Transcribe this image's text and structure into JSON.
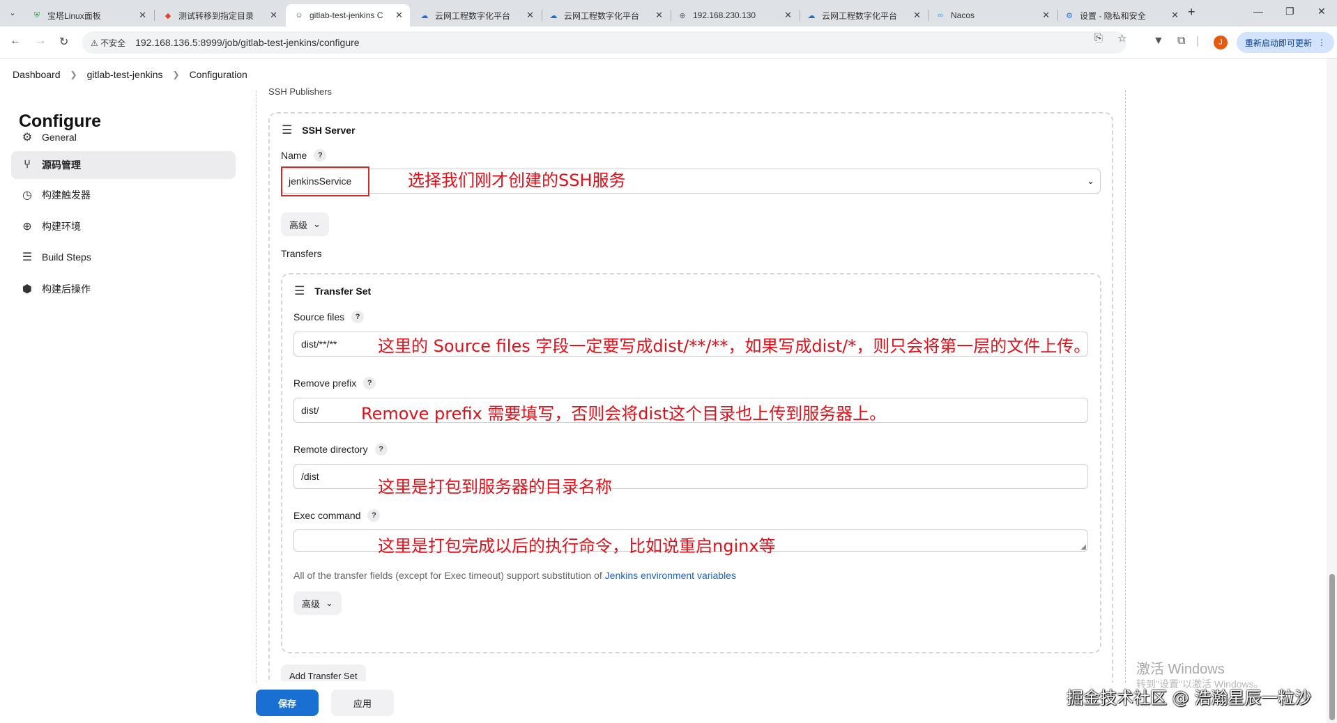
{
  "browser": {
    "tabs": [
      {
        "title": "宝塔Linux面板",
        "icon": "shield-icon",
        "color": "#20a53a",
        "active": false
      },
      {
        "title": "测试转移到指定目录",
        "icon": "gitlab-icon",
        "color": "#e24329",
        "active": false
      },
      {
        "title": "gitlab-test-jenkins C",
        "icon": "jenkins-icon",
        "color": "#555555",
        "active": true
      },
      {
        "title": "云网工程数字化平台",
        "icon": "cloud-icon",
        "color": "#1f6fd1",
        "active": false
      },
      {
        "title": "云网工程数字化平台",
        "icon": "cloud-icon",
        "color": "#1f6fd1",
        "active": false
      },
      {
        "title": "192.168.230.130",
        "icon": "globe-icon",
        "color": "#666666",
        "active": false
      },
      {
        "title": "云网工程数字化平台",
        "icon": "cloud-icon",
        "color": "#1f6fd1",
        "active": false
      },
      {
        "title": "Nacos",
        "icon": "nacos-icon",
        "color": "#2fa7e0",
        "active": false
      },
      {
        "title": "设置 - 隐私和安全",
        "icon": "gear-icon",
        "color": "#1a73e8",
        "active": false
      }
    ],
    "security_label": "不安全",
    "url": "192.168.136.5:8999/job/gitlab-test-jenkins/configure",
    "avatar_letter": "J",
    "relaunch_label": "重新启动即可更新"
  },
  "breadcrumb": [
    "Dashboard",
    "gitlab-test-jenkins",
    "Configuration"
  ],
  "sidebar": {
    "title": "Configure",
    "items": [
      {
        "label": "General",
        "icon": "gear-icon",
        "active": false
      },
      {
        "label": "源码管理",
        "icon": "branch-icon",
        "active": true
      },
      {
        "label": "构建触发器",
        "icon": "clock-icon",
        "active": false
      },
      {
        "label": "构建环境",
        "icon": "globe-icon",
        "active": false
      },
      {
        "label": "Build Steps",
        "icon": "list-icon",
        "active": false
      },
      {
        "label": "构建后操作",
        "icon": "cube-icon",
        "active": false
      }
    ]
  },
  "main": {
    "section_label": "SSH Publishers",
    "ssh_server": {
      "heading": "SSH Server",
      "name_label": "Name",
      "name_value": "jenkinsService",
      "annotation": "选择我们刚才创建的SSH服务",
      "advanced_label": "高级"
    },
    "transfers_label": "Transfers",
    "transfer_set": {
      "heading": "Transfer Set",
      "source_files": {
        "label": "Source files",
        "value": "dist/**/**",
        "annotation": "这里的 Source files 字段一定要写成dist/**/**，如果写成dist/*，则只会将第一层的文件上传。"
      },
      "remove_prefix": {
        "label": "Remove prefix",
        "value": "dist/",
        "annotation": "Remove prefix 需要填写，否则会将dist这个目录也上传到服务器上。"
      },
      "remote_directory": {
        "label": "Remote directory",
        "value": "/dist",
        "annotation": "这里是打包到服务器的目录名称"
      },
      "exec_command": {
        "label": "Exec command",
        "value": "",
        "annotation": "这里是打包完成以后的执行命令，比如说重启nginx等"
      },
      "note_text": "All of the transfer fields (except for Exec timeout) support substitution of ",
      "note_link": "Jenkins environment variables",
      "advanced_label": "高级"
    },
    "add_transfer_set_label": "Add Transfer Set",
    "help_glyph": "?"
  },
  "footer": {
    "save_label": "保存",
    "apply_label": "应用"
  },
  "overlay": {
    "windows_activate": "激活 Windows",
    "windows_activate_sub": "转到\"设置\"以激活 Windows。",
    "watermark": "掘金技术社区 @ 浩瀚星辰一粒沙"
  },
  "colors": {
    "accent": "#1970d2",
    "annotation_red": "#e3101a",
    "link": "#1f5fc4"
  }
}
